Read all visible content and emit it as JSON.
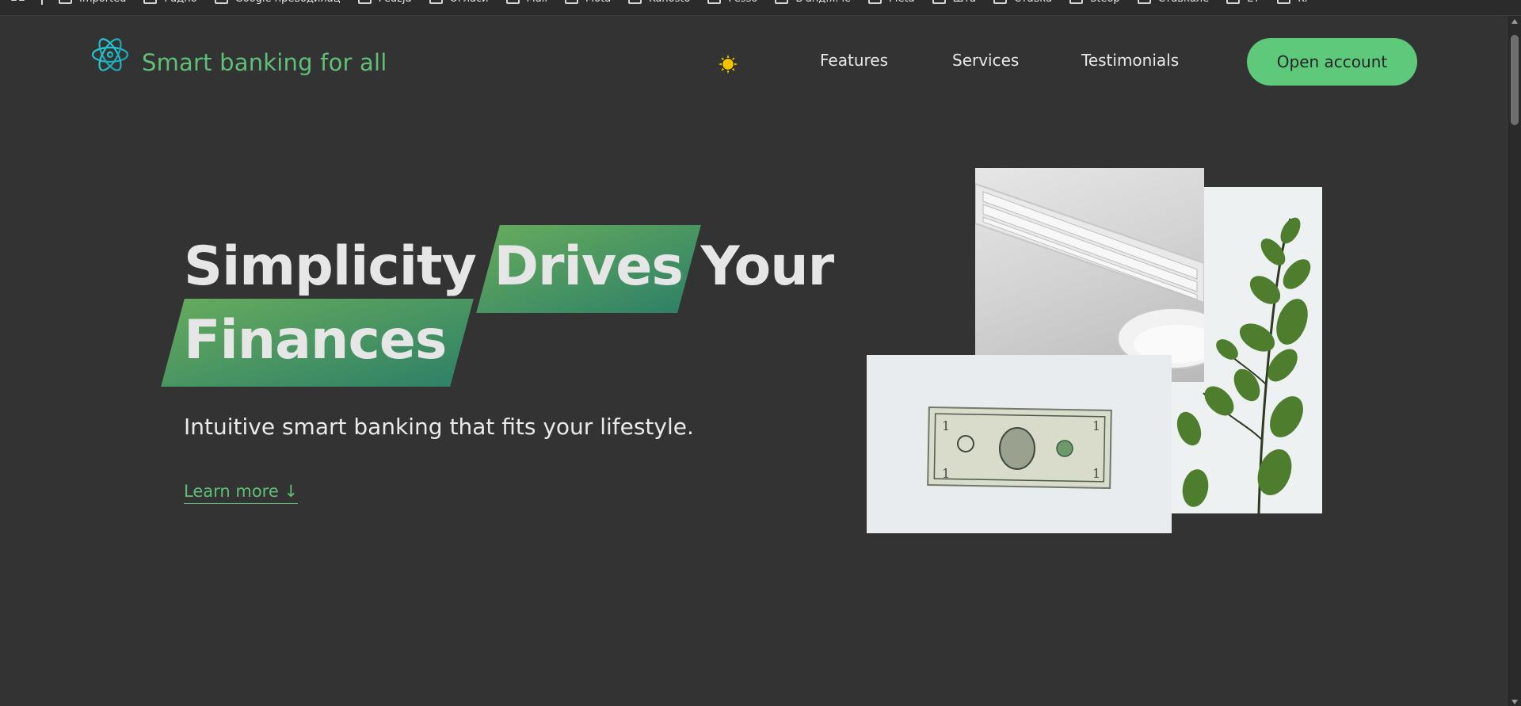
{
  "bookmarks_bar": {
    "items": [
      "Imported",
      "Радно",
      "Google преводилац",
      "Pedzja",
      "Огласи",
      "Mail",
      "Mota",
      "Kanosto",
      "Pesso",
      "Б'анд.я.че",
      "Pleta",
      "Шта",
      "Ставка",
      "Steop",
      "Ставкале",
      "ET",
      "Ki"
    ]
  },
  "nav": {
    "brand": "Smart banking for all",
    "theme_toggle_icon": "sun-icon",
    "links": [
      "Features",
      "Services",
      "Testimonials"
    ],
    "cta": "Open account"
  },
  "hero": {
    "title_word_1": "Simplicity",
    "title_word_2": "Drives",
    "title_word_3": "Your",
    "title_word_4": "Finances",
    "subtitle": "Intuitive smart banking that fits your lifestyle.",
    "learn_more": "Learn more ↓"
  },
  "colors": {
    "background": "#333333",
    "accent": "#5fbf78",
    "cta_bg": "#5ec97b",
    "highlight_from": "#6ab762",
    "highlight_to": "#2f8a6d"
  }
}
